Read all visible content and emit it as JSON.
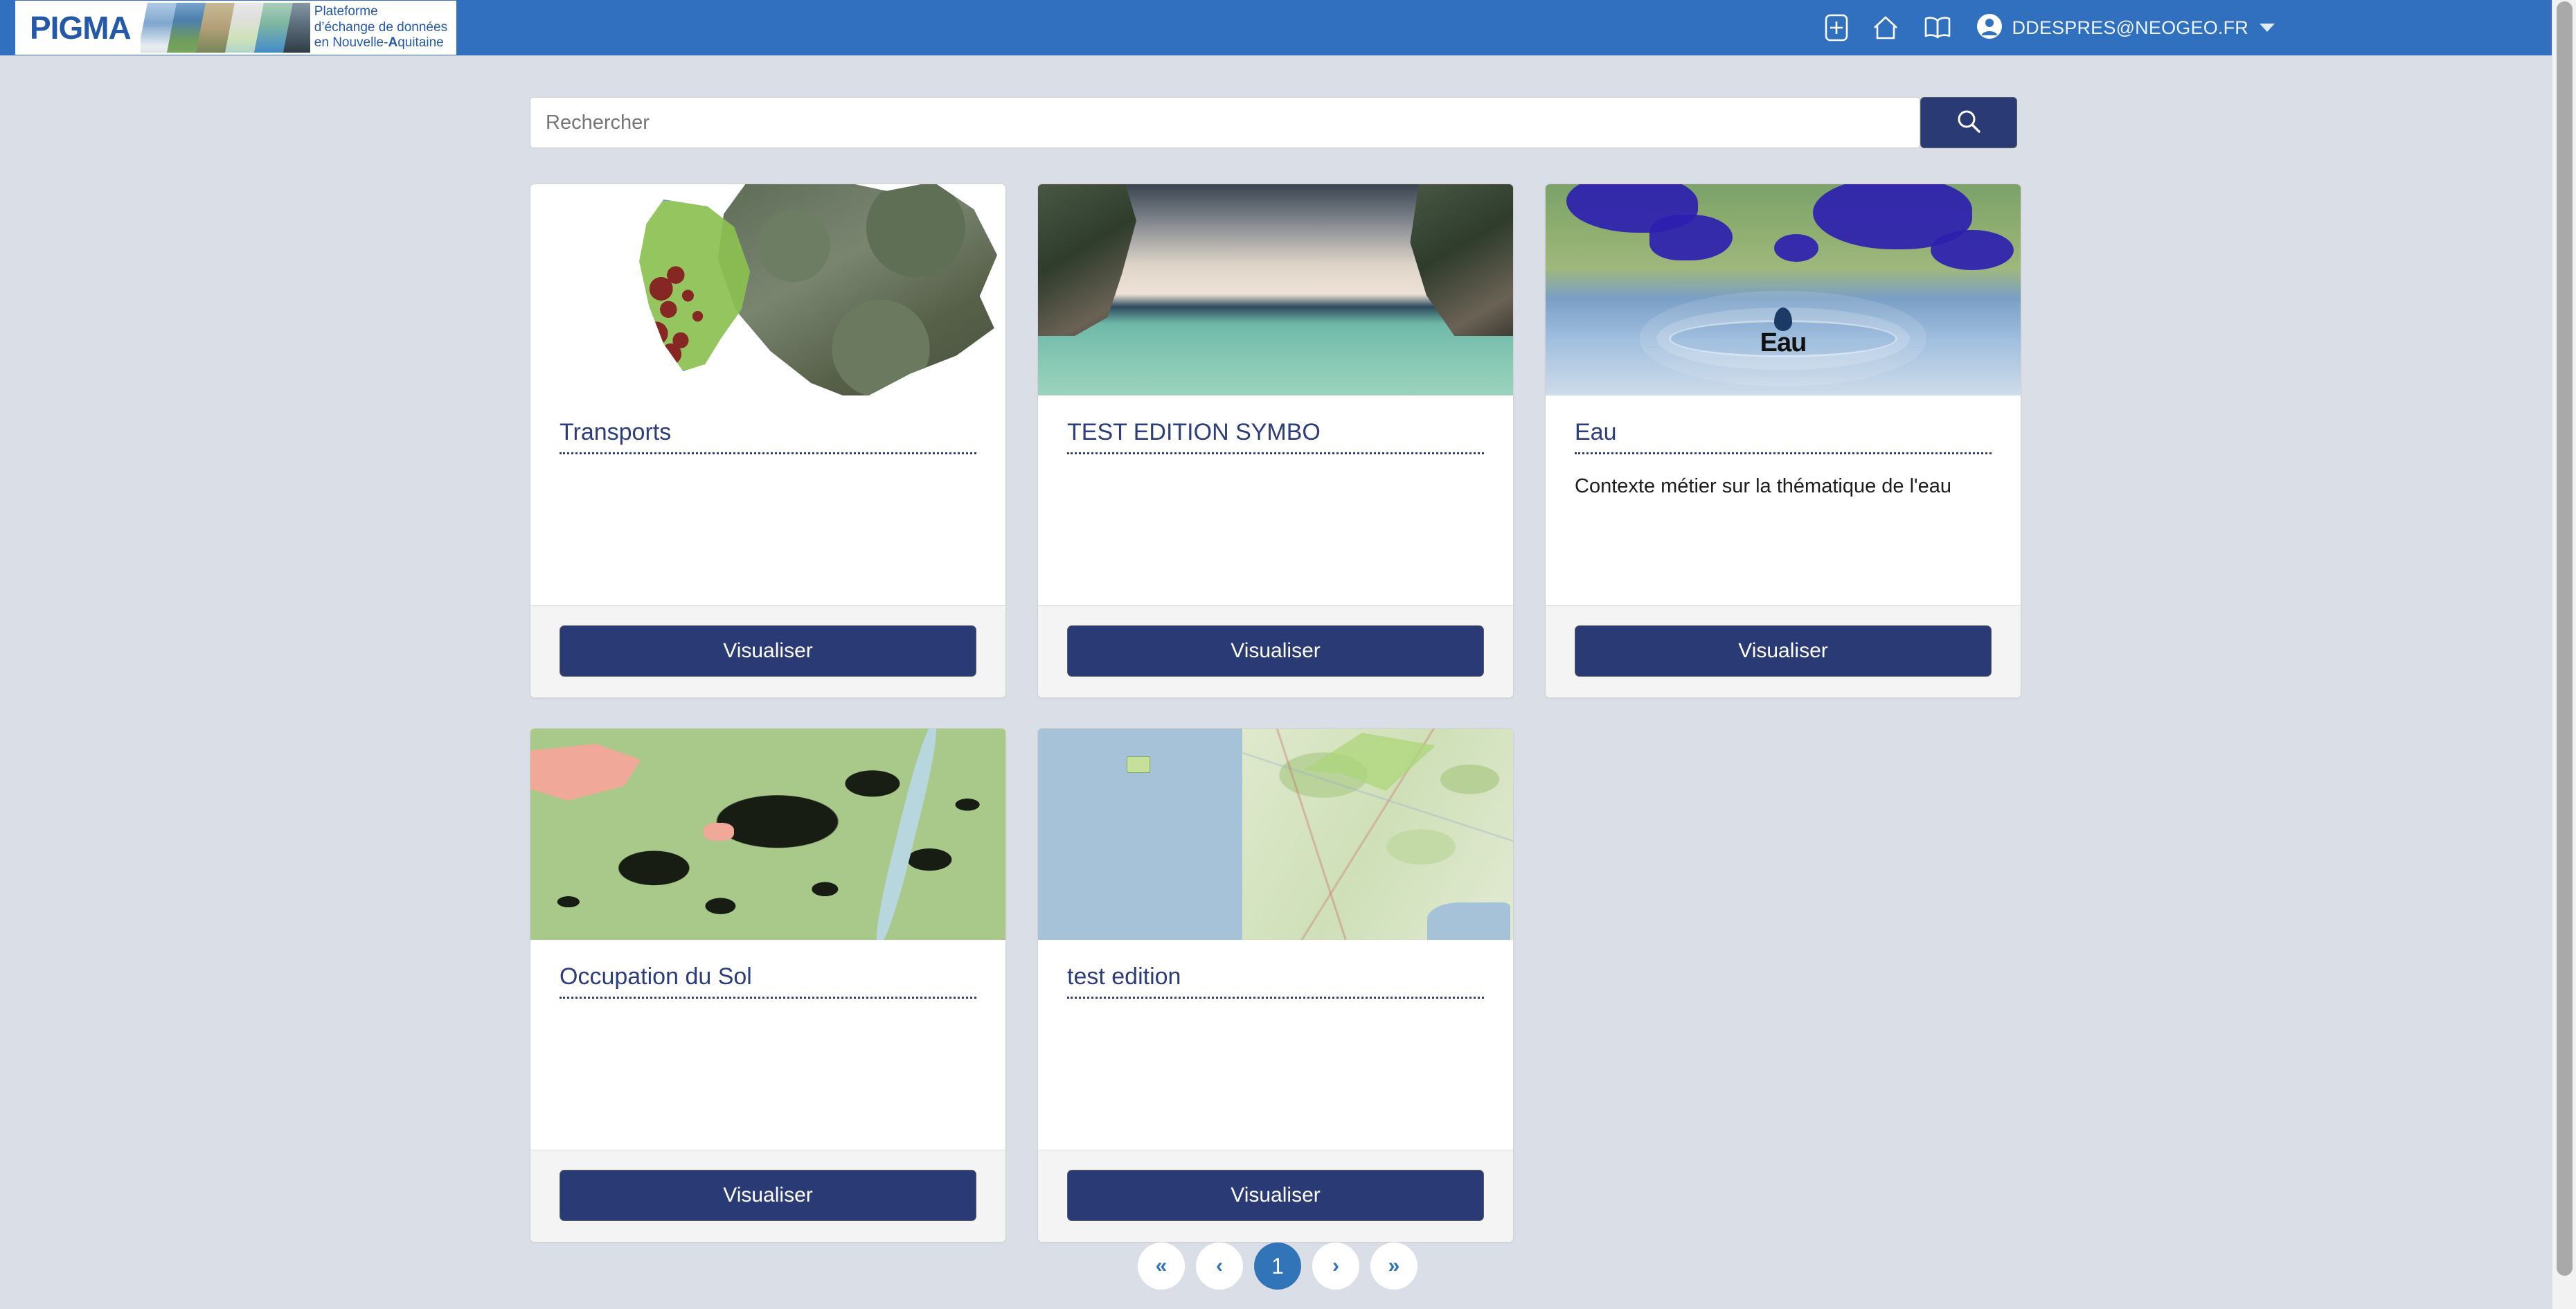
{
  "header": {
    "logo": {
      "word": "PIGMA",
      "tagline_line1": "Plateforme",
      "tagline_line2": "d’échange de données",
      "tagline_line3_a": "en Nouvelle-",
      "tagline_line3_b": "A",
      "tagline_line3_c": "quitaine",
      "strip_icon": "photo-strip"
    },
    "icons": [
      {
        "name": "add-icon",
        "label": "+"
      },
      {
        "name": "home-icon",
        "label": "home"
      },
      {
        "name": "book-icon",
        "label": "book"
      }
    ],
    "user": {
      "email": "DDESPRES@NEOGEO.FR",
      "avatar_icon": "user-circle-icon",
      "caret_icon": "chevron-down-icon"
    },
    "background_color": "#3070bf"
  },
  "search": {
    "placeholder": "Rechercher",
    "value": "",
    "button_icon": "search-icon",
    "button_color": "#2a3a74"
  },
  "cards": [
    {
      "title": "Transports",
      "description": "",
      "button_label": "Visualiser",
      "image_name": "carte-transports-nouvelle-aquitaine"
    },
    {
      "title": "TEST EDITION SYMBO",
      "description": "",
      "button_label": "Visualiser",
      "image_name": "photo-falaises-lagon"
    },
    {
      "title": "Eau",
      "description": "Contexte métier sur la thématique de l'eau",
      "button_label": "Visualiser",
      "image_name": "goutte-eau-carte"
    },
    {
      "title": "Occupation du Sol",
      "description": "",
      "button_label": "Visualiser",
      "image_name": "carte-occupation-du-sol"
    },
    {
      "title": "test edition",
      "description": "",
      "button_label": "Visualiser",
      "image_name": "carte-littoral-atlantique"
    }
  ],
  "pagination": {
    "first_label": "«",
    "prev_label": "‹",
    "pages": [
      "1"
    ],
    "current_page": "1",
    "next_label": "›",
    "last_label": "»",
    "active_color": "#3274b8"
  },
  "theme": {
    "page_background": "#dadee6",
    "card_background": "#ffffff",
    "card_footer_background": "#f4f4f4",
    "title_color": "#2b3d7d",
    "accent_navy": "#2a3a74",
    "header_blue": "#3070bf",
    "logo_blue": "#2458a8"
  }
}
